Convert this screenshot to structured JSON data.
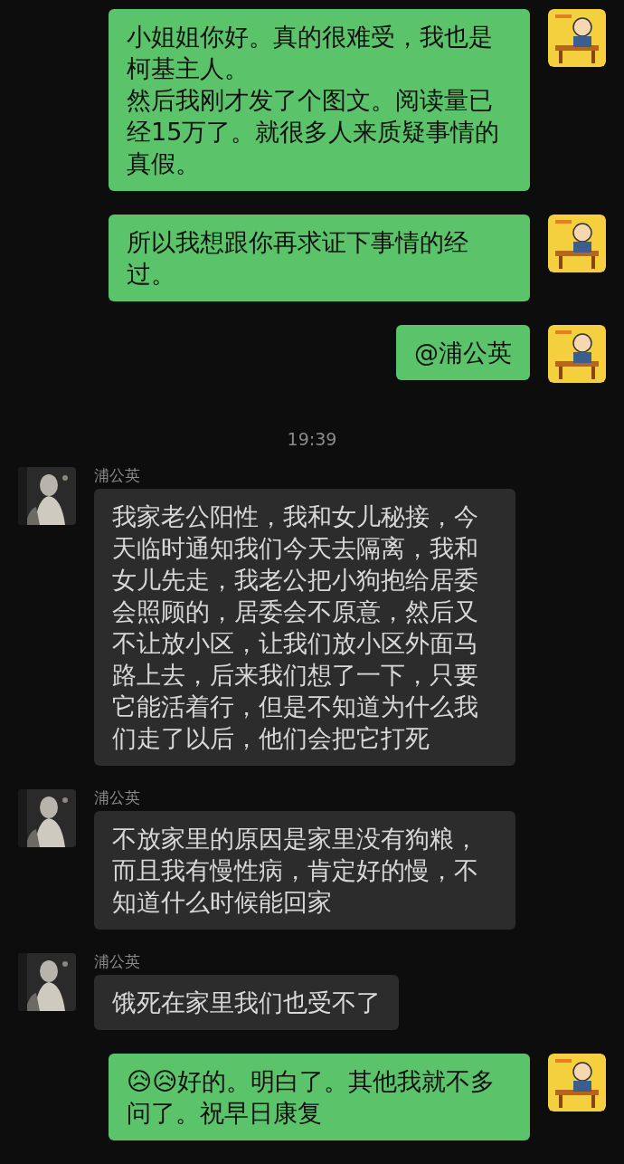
{
  "messages": [
    {
      "kind": "sent",
      "parts": [
        {
          "kind": "text",
          "text": "小姐姐你好。真的很难受，我也是柯基主人。"
        },
        {
          "kind": "text",
          "text": "然后我刚才发了个图文。阅读量已经15万了。就很多人来质疑事情的真假。"
        }
      ]
    },
    {
      "kind": "sent",
      "parts": [
        {
          "kind": "text",
          "text": "所以我想跟你再求证下事情的经过。"
        }
      ]
    },
    {
      "kind": "sent",
      "parts": [
        {
          "kind": "text",
          "text": "@浦公英"
        }
      ]
    },
    {
      "kind": "time",
      "text": "19:39"
    },
    {
      "kind": "received",
      "sender": "浦公英",
      "parts": [
        {
          "kind": "text",
          "text": "我家老公阳性，我和女儿秘接，今天临时通知我们今天去隔离，我和女儿先走，我老公把小狗抱给居委会照顾的，居委会不原意，然后又不让放小区，让我们放小区外面马路上去，后来我们想了一下，只要它能活着行，但是不知道为什么我们走了以后，他们会把它打死"
        }
      ]
    },
    {
      "kind": "received",
      "sender": "浦公英",
      "parts": [
        {
          "kind": "text",
          "text": "不放家里的原因是家里没有狗粮，而且我有慢性病，肯定好的慢，不知道什么时候能回家"
        }
      ]
    },
    {
      "kind": "received",
      "sender": "浦公英",
      "parts": [
        {
          "kind": "text",
          "text": "饿死在家里我们也受不了"
        }
      ]
    },
    {
      "kind": "sent",
      "parts": [
        {
          "kind": "text",
          "text": "😥😥好的。明白了。其他我就不多问了。祝早日康复"
        }
      ]
    }
  ]
}
